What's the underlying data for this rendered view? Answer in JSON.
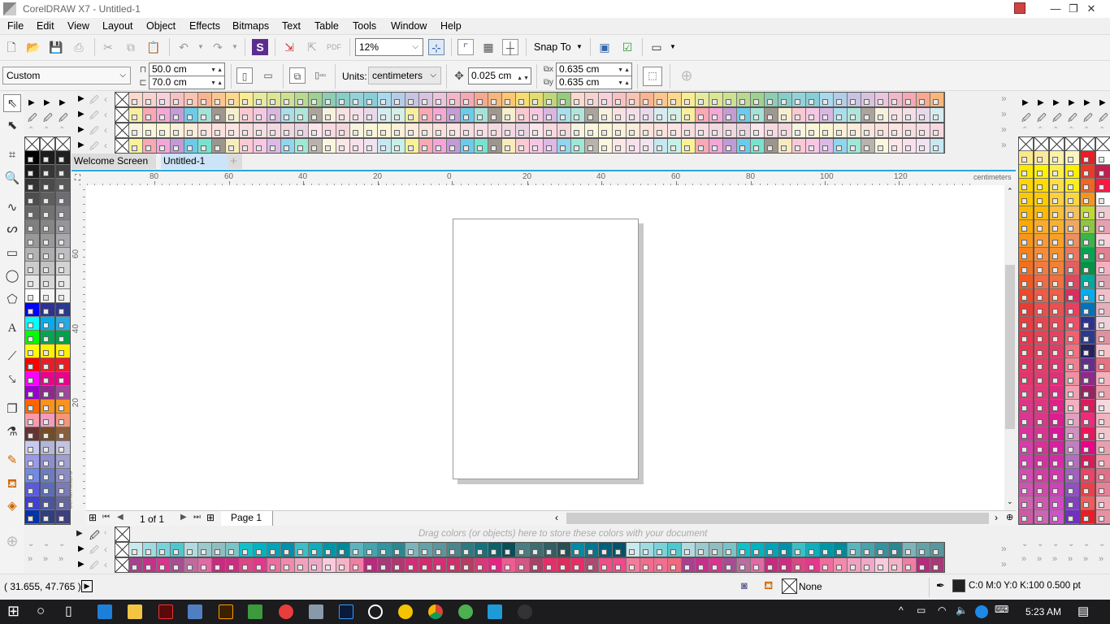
{
  "window": {
    "title": "CorelDRAW X7 - Untitled-1",
    "minimize": "—",
    "restore": "❐",
    "close": "✕"
  },
  "menu": [
    "File",
    "Edit",
    "View",
    "Layout",
    "Object",
    "Effects",
    "Bitmaps",
    "Text",
    "Table",
    "Tools",
    "Window",
    "Help"
  ],
  "toolbar": {
    "zoom": "12%",
    "snap_to": "Snap To"
  },
  "property_bar": {
    "page_size": "Custom",
    "width": "50.0 cm",
    "height": "70.0 cm",
    "units_label": "Units:",
    "units": "centimeters",
    "nudge": "0.025 cm",
    "dup_x": "0.635 cm",
    "dup_y": "0.635 cm"
  },
  "tabs": [
    {
      "label": "Welcome Screen",
      "active": false
    },
    {
      "label": "Untitled-1",
      "active": true
    }
  ],
  "ruler": {
    "h_labels": [
      "80",
      "60",
      "40",
      "20",
      "0",
      "20",
      "40",
      "60",
      "80",
      "100",
      "120"
    ],
    "v_labels": [
      "60",
      "40",
      "20"
    ],
    "unit": "centimeters"
  },
  "page_nav": {
    "count": "1 of 1",
    "page_tab": "Page 1"
  },
  "document_palette": {
    "hint": "Drag colors (or objects) here to store these colors with your document"
  },
  "status": {
    "coords": "( 31.655, 47.765 )",
    "fill": "None",
    "outline": "C:0 M:0 Y:0 K:100  0.500 pt"
  },
  "taskbar": {
    "time": "5:23 AM"
  },
  "colors": {
    "accent": "#29a8e0",
    "tab_active": "#cce4f7"
  },
  "palettes": {
    "top": [
      [
        "#fbd9cc",
        "#f6d3cf",
        "#f8d1dc",
        "#f7c1c3",
        "#f9c4b3",
        "#f9b491",
        "#fbc68f",
        "#fcd98c",
        "#fbec93",
        "#e5eaa0",
        "#dbe792",
        "#cde291",
        "#b8d98f",
        "#9fd190",
        "#8ccdb3",
        "#86cec6",
        "#95d2d8",
        "#88ced7",
        "#a9d9ec",
        "#b3cde9",
        "#c8c3e2",
        "#d8c3df",
        "#ebc4dd",
        "#f2b7cb",
        "#f5a8b6",
        "#f6a890",
        "#f7b67b",
        "#fbc772",
        "#f8de70",
        "#e3dd71",
        "#bfd778",
        "#96cb7e"
      ],
      [
        "#f7ef9e",
        "#f9a8b5",
        "#f4a8d6",
        "#c59dd5",
        "#6dcbe9",
        "#a5e2d8",
        "#9f9890",
        "#f5efce",
        "#f9c9d2",
        "#f4c8e2",
        "#d8b7e0",
        "#a9dfea",
        "#b0e6da",
        "#aba49a",
        "#f6f1dc",
        "#f7e1e1",
        "#f4dfe8",
        "#e8d9ea",
        "#d7ecf0",
        "#d5efe6"
      ],
      [
        "#f9f4e0",
        "#fbf5d9",
        "#fbf6d5",
        "#fbf0d8",
        "#fcecd9",
        "#fbe4dc",
        "#fbe0dc",
        "#fde4e2",
        "#f7dde0",
        "#f5dde3",
        "#f5d9e0",
        "#f0d7e0",
        "#e9d3e0",
        "#fce6ec",
        "#f8d9df",
        "#f4d6dc"
      ],
      [
        "#faf294",
        "#f9a9b5",
        "#f6a4dc",
        "#c39ad8",
        "#6ccbeb",
        "#77e3cf",
        "#9c968e",
        "#f9ecbc",
        "#fbc9d3",
        "#f9c7e6",
        "#dcb9e6",
        "#8fd6ee",
        "#9ee8d6",
        "#b9b3ab",
        "#fcf6dd",
        "#fde6e6",
        "#fadfec",
        "#f2e3f0",
        "#c6e8f0",
        "#c7f0e6"
      ]
    ],
    "bottom": [
      [
        "#c9e9ee",
        "#a0dbe2",
        "#79d2d8",
        "#4fc7cd",
        "#b3dade",
        "#9cc9cc",
        "#91bcc0",
        "#7ac3c7",
        "#12c0c8",
        "#00b3c1",
        "#00a3b8",
        "#0090aa",
        "#3bbfc4",
        "#12adbb",
        "#0095a6",
        "#008999",
        "#5db4bd",
        "#47a3ac",
        "#33939e",
        "#2c8690",
        "#7cb4b9",
        "#64a2a7",
        "#5a969b",
        "#4a868b",
        "#2c7a80",
        "#16727a",
        "#0e6069",
        "#0a4d56",
        "#4b7c80",
        "#3f6c70",
        "#335e62",
        "#274f53",
        "#008aa5",
        "#00768f",
        "#006079",
        "#00536a"
      ],
      [
        "#a9408f",
        "#c72f8b",
        "#d9338f",
        "#a84d93",
        "#bc6c9f",
        "#e06aa5",
        "#c82a80",
        "#cb2e80",
        "#d94784",
        "#e3388c",
        "#ed6e9e",
        "#f28aad",
        "#f1a1bf",
        "#f0a8c9",
        "#f8cadb",
        "#f6b2c6",
        "#ee7ea4",
        "#b82a7d",
        "#a63a78",
        "#b0386e",
        "#d42c78",
        "#d42a6f",
        "#d92c77",
        "#d02f6b",
        "#b83c62",
        "#d93878",
        "#e62385",
        "#ee5d92",
        "#d45685",
        "#a64266",
        "#e52e6a",
        "#e02c5c",
        "#e92c68",
        "#ad4a72",
        "#ee4e86",
        "#f0488b",
        "#f37b9c",
        "#f06c8b",
        "#ee6f91",
        "#f0697c"
      ]
    ],
    "left": [
      [
        "#000000",
        "#1a1a1a",
        "#333333",
        "#4d4d4d",
        "#666666",
        "#808080",
        "#999999",
        "#b3b3b3",
        "#cccccc",
        "#e6e6e6",
        "#ffffff",
        "#0000ff",
        "#00ffff",
        "#00ff00",
        "#ffff00",
        "#ff0000",
        "#ff00ff",
        "#9900cc",
        "#ff6600",
        "#ff99aa",
        "#663333",
        "#c9c9f0",
        "#9999ee",
        "#6f8ae8",
        "#5a5ae0",
        "#3f3fd0",
        "#0033aa",
        "#000066"
      ],
      [
        "#1c1c1c",
        "#363636",
        "#4a4a4a",
        "#5e5e5e",
        "#727272",
        "#868686",
        "#9a9a9a",
        "#aeaeae",
        "#c2c2c2",
        "#d6d6d6",
        "#f5f5f5",
        "#2e3192",
        "#00aeef",
        "#00a651",
        "#fff200",
        "#ed1c24",
        "#ec008c",
        "#92278f",
        "#f7941d",
        "#f49ac1",
        "#754c24",
        "#b5b5d8",
        "#8e8ecf",
        "#6b7cc0",
        "#5a6cb8",
        "#4a55a0",
        "#2e3e80",
        "#242a60"
      ],
      [
        "#231f20",
        "#414042",
        "#58595b",
        "#6d6e71",
        "#808285",
        "#939598",
        "#a7a9ac",
        "#bcbec0",
        "#d1d3d4",
        "#e6e7e8",
        "#f1f2f2",
        "#2b3990",
        "#27aae1",
        "#00a14b",
        "#fff200",
        "#ed1c24",
        "#ec008c",
        "#a0489a",
        "#f7941d",
        "#f69679",
        "#8b5e3c",
        "#c3c3e0",
        "#a09fd0",
        "#8c8cc4",
        "#7b7bb8",
        "#6565a0",
        "#3e3e80",
        "#494670"
      ]
    ],
    "right": [
      [
        "#fbe88a",
        "#fde800",
        "#fdd500",
        "#fbc900",
        "#fbb800",
        "#fbaa00",
        "#f7961e",
        "#f58220",
        "#f26f21",
        "#ef5a24",
        "#ec4a2c",
        "#e93b33",
        "#e93d3f",
        "#e8374b",
        "#e83655",
        "#e63562",
        "#e3346c",
        "#e03a7a",
        "#de3686",
        "#dc3592",
        "#d9349e",
        "#d73da8",
        "#d53caf",
        "#d44ab2",
        "#cf53b2",
        "#d162b0",
        "#ce5aa6",
        "#cb5aa0"
      ],
      [
        "#fde99a",
        "#fff200",
        "#fedc00",
        "#fecb00",
        "#feb900",
        "#fdaa2a",
        "#f89a33",
        "#f68b3a",
        "#f47a3f",
        "#f16a44",
        "#ee5c47",
        "#eb4e4b",
        "#e9444f",
        "#e74257",
        "#e5405f",
        "#e33e67",
        "#e13c6f",
        "#df3a77",
        "#dd387f",
        "#db3687",
        "#d9348f",
        "#d73297",
        "#d5309f",
        "#d33da5",
        "#d14aab",
        "#cf57b0",
        "#cd64b5",
        "#cb71ba"
      ],
      [
        "#fdf0a8",
        "#fdee50",
        "#fde048",
        "#fcd040",
        "#fbc038",
        "#f9b030",
        "#f7a028",
        "#f49030",
        "#f28038",
        "#ef7040",
        "#ec6048",
        "#ea5050",
        "#e84858",
        "#e64260",
        "#e43c68",
        "#e23670",
        "#e03078",
        "#de2a80",
        "#dc2488",
        "#da1e90",
        "#d81898",
        "#d622a0",
        "#d42ca8",
        "#d236b0",
        "#d040b8",
        "#ce4ac0",
        "#cc54c8",
        "#ca5ed0"
      ],
      [
        "#fdf5c0",
        "#fbf000",
        "#faed20",
        "#f8d840",
        "#f5c060",
        "#f0a860",
        "#eb9060",
        "#e67860",
        "#e16060",
        "#dc4860",
        "#d73060",
        "#e84060",
        "#ec5068",
        "#f06070",
        "#f07080",
        "#f08090",
        "#f090a0",
        "#f0a0b0",
        "#f0b0c0",
        "#e0a0c0",
        "#d090c0",
        "#c080c0",
        "#b070c0",
        "#a060c0",
        "#9050c0",
        "#8040c0",
        "#7030c0",
        "#6020c0"
      ],
      [
        "#ed1c24",
        "#ee3a24",
        "#f26522",
        "#f7941d",
        "#c1d82f",
        "#8dc63f",
        "#39b54a",
        "#00a651",
        "#009444",
        "#00a99d",
        "#00aeef",
        "#0072bc",
        "#2e3192",
        "#2b3990",
        "#262262",
        "#662d91",
        "#92278f",
        "#9e1f63",
        "#da1c5c",
        "#ee2a7b",
        "#ed145b",
        "#ec008c",
        "#d91b5c",
        "#ee4266",
        "#ef3e4a",
        "#f15a5a",
        "#ed1c24",
        "#c2185b"
      ],
      [
        "#ffffff",
        "#c31e50",
        "#ff1744",
        "#ffffff",
        "#f0c8d0",
        "#e8a0b0",
        "#f5d0d8",
        "#e08090",
        "#f5b0c0",
        "#d8a0b0",
        "#f0c0c8",
        "#e4b0bc",
        "#f0d0d8",
        "#e090a0",
        "#f5c0c8",
        "#e87080",
        "#f4b0bc",
        "#eba0ac",
        "#f5d8e0",
        "#f0b4c0",
        "#f2c4cc",
        "#e8a0b0",
        "#ec98a8",
        "#e07088",
        "#e88098",
        "#f0a8b8",
        "#e890a4",
        "#f4b4c4"
      ]
    ]
  }
}
